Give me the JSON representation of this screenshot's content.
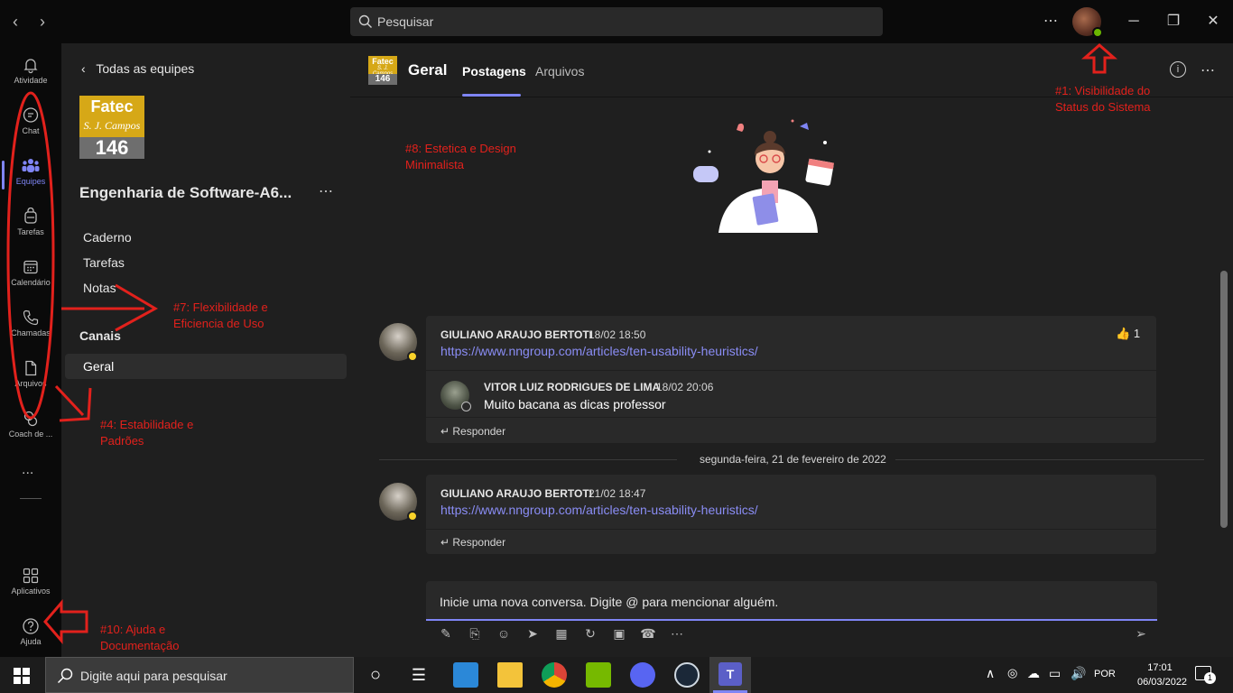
{
  "search": {
    "placeholder": "Pesquisar"
  },
  "appbar": {
    "items": [
      {
        "label": "Atividade",
        "icon": "bell-icon"
      },
      {
        "label": "Chat",
        "icon": "chat-icon"
      },
      {
        "label": "Equipes",
        "icon": "teams-icon"
      },
      {
        "label": "Tarefas",
        "icon": "tasks-icon"
      },
      {
        "label": "Calendário",
        "icon": "calendar-icon"
      },
      {
        "label": "Chamadas",
        "icon": "phone-icon"
      },
      {
        "label": "Arquivos",
        "icon": "file-icon"
      },
      {
        "label": "Coach de ...",
        "icon": "coach-icon"
      }
    ],
    "more": "...",
    "apps_label": "Aplicativos",
    "help_label": "Ajuda"
  },
  "team_panel": {
    "back_label": "Todas as equipes",
    "logo": {
      "line1": "Fatec",
      "line2": "S. J. Campos",
      "line3": "146"
    },
    "team_name": "Engenharia de Software-A6...",
    "tabs": [
      "Caderno",
      "Tarefas",
      "Notas"
    ],
    "channels_header": "Canais",
    "channels": [
      "Geral"
    ]
  },
  "channel_header": {
    "logo": {
      "line1": "Fatec",
      "line2": "S. J. Campos",
      "line3": "146"
    },
    "title": "Geral",
    "tabs": [
      "Postagens",
      "Arquivos"
    ],
    "active_tab": "Postagens"
  },
  "posts": [
    {
      "author": "GIULIANO ARAUJO BERTOTI",
      "time": "18/02 18:50",
      "link": "https://www.nngroup.com/articles/ten-usability-heuristics/",
      "reaction": {
        "emoji": "👍",
        "count": "1"
      },
      "replies": [
        {
          "author": "VITOR LUIZ RODRIGUES DE LIMA",
          "time": "18/02 20:06",
          "text": "Muito bacana as dicas professor"
        }
      ],
      "reply_label": "Responder"
    },
    {
      "author": "GIULIANO ARAUJO BERTOTI",
      "time": "21/02 18:47",
      "link": "https://www.nngroup.com/articles/ten-usability-heuristics/",
      "reply_label": "Responder"
    }
  ],
  "date_divider": "segunda-feira, 21 de fevereiro de 2022",
  "compose": {
    "placeholder": "Inicie uma nova conversa. Digite @ para mencionar alguém."
  },
  "annotations": {
    "a1": [
      "#1: Visibilidade do",
      "Status do Sistema"
    ],
    "a4": [
      "#4: Estabilidade e",
      "Padrões"
    ],
    "a7": [
      "#7: Flexibilidade e",
      "Eficiencia de Uso"
    ],
    "a8": [
      "#8: Estetica e Design",
      "Minimalista"
    ],
    "a10": [
      "#10: Ajuda e",
      "Documentação"
    ]
  },
  "taskbar": {
    "search_placeholder": "Digite aqui para pesquisar",
    "lang": "POR",
    "time": "17:01",
    "date": "06/03/2022",
    "notif_count": "1"
  },
  "colors": {
    "accent": "#7f85f5",
    "annotation": "#e2211c",
    "brand_logo": "#d6a817",
    "status_available": "#6bb700",
    "status_away": "#f8d22a"
  }
}
